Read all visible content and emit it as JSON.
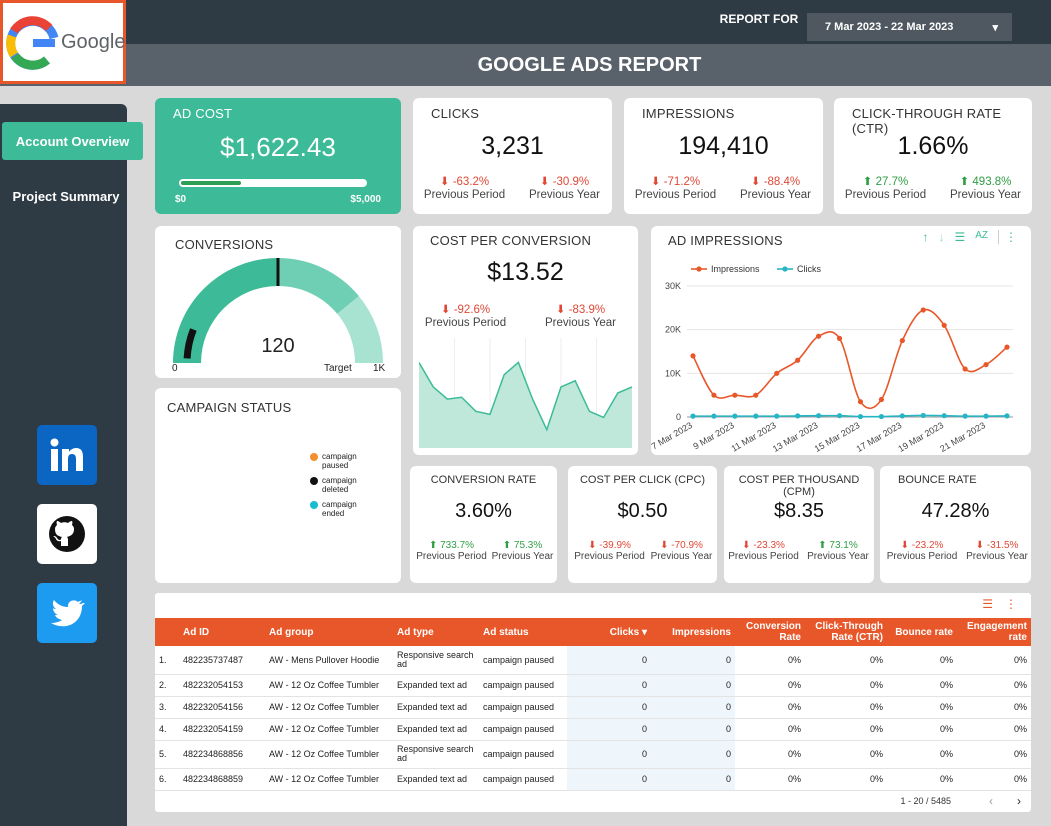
{
  "header": {
    "title": "GOOGLE ADS REPORT",
    "report_for": "REPORT FOR",
    "date_range": "7 Mar 2023 - 22 Mar 2023",
    "logo_text": "Google"
  },
  "nav": {
    "items": [
      "Account Overview",
      "Project Summary"
    ]
  },
  "social": [
    "linkedin-icon",
    "github-icon",
    "twitter-icon"
  ],
  "ad_cost": {
    "label": "AD COST",
    "value": "$1,622.43",
    "min": "$0",
    "max": "$5,000",
    "progress": 0.3245
  },
  "kpis": [
    {
      "label": "CLICKS",
      "value": "3,231",
      "prev_period": "-63.2%",
      "prev_year": "-30.9%",
      "pp_dir": "down",
      "py_dir": "down"
    },
    {
      "label": "IMPRESSIONS",
      "value": "194,410",
      "prev_period": "-71.2%",
      "prev_year": "-88.4%",
      "pp_dir": "down",
      "py_dir": "down"
    },
    {
      "label": "CLICK-THROUGH RATE (CTR)",
      "value": "1.66%",
      "prev_period": "27.7%",
      "prev_year": "493.8%",
      "pp_dir": "up",
      "py_dir": "up"
    }
  ],
  "compare_labels": {
    "period": "Previous Period",
    "year": "Previous Year"
  },
  "conversions": {
    "label": "CONVERSIONS",
    "value": "120",
    "min": "0",
    "max": "1K",
    "target_label": "Target",
    "value_fraction": 0.12,
    "target_fraction": 0.5
  },
  "cost_per_conversion": {
    "label": "COST PER CONVERSION",
    "value": "$13.52",
    "prev_period": "-92.6%",
    "prev_year": "-83.9%",
    "sparkline": [
      14,
      10,
      8,
      8.3,
      6,
      5.5,
      12,
      14,
      8,
      3,
      10,
      11,
      6,
      5,
      9,
      10
    ]
  },
  "campaign_status": {
    "label": "CAMPAIGN STATUS",
    "legend": [
      {
        "name": "campaign paused",
        "color": "#f28e2b"
      },
      {
        "name": "campaign deleted",
        "color": "#111111"
      },
      {
        "name": "campaign ended",
        "color": "#17becf"
      }
    ]
  },
  "ad_impressions": {
    "label": "AD IMPRESSIONS",
    "chart_data": {
      "type": "line",
      "x": [
        "7 Mar 2023",
        "8 Mar 2023",
        "9 Mar 2023",
        "10 Mar 2023",
        "11 Mar 2023",
        "12 Mar 2023",
        "13 Mar 2023",
        "14 Mar 2023",
        "15 Mar 2023",
        "16 Mar 2023",
        "17 Mar 2023",
        "18 Mar 2023",
        "19 Mar 2023",
        "20 Mar 2023",
        "21 Mar 2023",
        "22 Mar 2023"
      ],
      "xtick_labels": [
        "7 Mar 2023",
        "9 Mar 2023",
        "11 Mar 2023",
        "13 Mar 2023",
        "15 Mar 2023",
        "17 Mar 2023",
        "19 Mar 2023",
        "21 Mar 2023"
      ],
      "series": [
        {
          "name": "Impressions",
          "color": "#e8572a",
          "values": [
            14000,
            5000,
            5000,
            5000,
            10000,
            13000,
            18500,
            18000,
            3500,
            4000,
            17500,
            24500,
            21000,
            11000,
            12000,
            16000
          ]
        },
        {
          "name": "Clicks",
          "color": "#26b5c5",
          "values": [
            200,
            200,
            200,
            200,
            200,
            250,
            300,
            300,
            100,
            100,
            250,
            350,
            300,
            200,
            200,
            250
          ]
        }
      ],
      "ylim": [
        0,
        30000
      ],
      "yticks": [
        "0",
        "10K",
        "20K",
        "30K"
      ],
      "grid": true,
      "legend": "top-left"
    }
  },
  "small_kpis": [
    {
      "label": "CONVERSION RATE",
      "value": "3.60%",
      "prev_period": "733.7%",
      "prev_year": "75.3%",
      "pp_dir": "up",
      "py_dir": "up"
    },
    {
      "label": "COST PER CLICK (CPC)",
      "value": "$0.50",
      "prev_period": "-39.9%",
      "prev_year": "-70.9%",
      "pp_dir": "down",
      "py_dir": "down"
    },
    {
      "label": "COST PER THOUSAND (CPM)",
      "value": "$8.35",
      "prev_period": "-23.3%",
      "prev_year": "73.1%",
      "pp_dir": "down",
      "py_dir": "up"
    },
    {
      "label": "BOUNCE RATE",
      "value": "47.28%",
      "prev_period": "-23.2%",
      "prev_year": "-31.5%",
      "pp_dir": "down",
      "py_dir": "down"
    }
  ],
  "table": {
    "columns": [
      "Ad ID",
      "Ad group",
      "Ad type",
      "Ad status",
      "Clicks",
      "Impressions",
      "Conversion Rate",
      "Click-Through Rate (CTR)",
      "Bounce rate",
      "Engagement rate"
    ],
    "rows": [
      [
        "1.",
        "482235737487",
        "AW - Mens Pullover Hoodie",
        "Responsive search ad",
        "campaign paused",
        "0",
        "0",
        "0%",
        "0%",
        "0%",
        "0%"
      ],
      [
        "2.",
        "482232054153",
        "AW - 12 Oz Coffee Tumbler",
        "Expanded text ad",
        "campaign paused",
        "0",
        "0",
        "0%",
        "0%",
        "0%",
        "0%"
      ],
      [
        "3.",
        "482232054156",
        "AW - 12 Oz Coffee Tumbler",
        "Expanded text ad",
        "campaign paused",
        "0",
        "0",
        "0%",
        "0%",
        "0%",
        "0%"
      ],
      [
        "4.",
        "482232054159",
        "AW - 12 Oz Coffee Tumbler",
        "Expanded text ad",
        "campaign paused",
        "0",
        "0",
        "0%",
        "0%",
        "0%",
        "0%"
      ],
      [
        "5.",
        "482234868856",
        "AW - 12 Oz Coffee Tumbler",
        "Responsive search ad",
        "campaign paused",
        "0",
        "0",
        "0%",
        "0%",
        "0%",
        "0%"
      ],
      [
        "6.",
        "482234868859",
        "AW - 12 Oz Coffee Tumbler",
        "Expanded text ad",
        "campaign paused",
        "0",
        "0",
        "0%",
        "0%",
        "0%",
        "0%"
      ]
    ],
    "pagination": "1 - 20 / 5485"
  }
}
